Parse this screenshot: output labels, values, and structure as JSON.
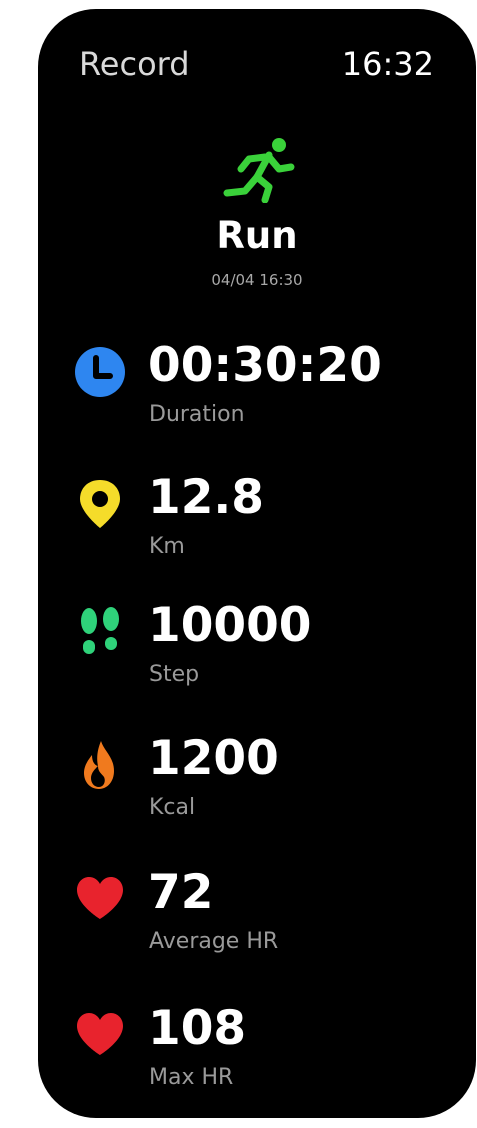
{
  "header": {
    "title": "Record",
    "time": "16:32"
  },
  "activity": {
    "icon": "running-person-icon",
    "icon_color": "#3ad13a",
    "name": "Run",
    "datetime": "04/04  16:30"
  },
  "stats": [
    {
      "icon": "clock-icon",
      "color": "#2e86f0",
      "value": "00:30:20",
      "label": "Duration"
    },
    {
      "icon": "location-pin-icon",
      "color": "#f5dc2a",
      "value": "12.8",
      "label": "Km"
    },
    {
      "icon": "footprints-icon",
      "color": "#2fd27a",
      "value": "10000",
      "label": "Step"
    },
    {
      "icon": "flame-icon",
      "color": "#f07a1e",
      "value": "1200",
      "label": "Kcal"
    },
    {
      "icon": "heart-icon",
      "color": "#e8232d",
      "value": "72",
      "label": "Average HR"
    },
    {
      "icon": "heart-icon",
      "color": "#e8232d",
      "value": "108",
      "label": "Max HR"
    }
  ]
}
